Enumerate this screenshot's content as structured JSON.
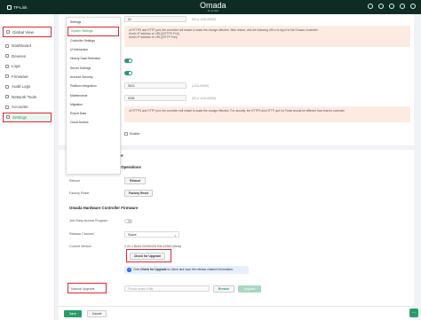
{
  "topbar": {
    "brand": "TP-Link",
    "product": "Omada",
    "product_sub": "by tp-link"
  },
  "sidebar": {
    "global_view": "Global View",
    "items": [
      {
        "label": "Dashboard",
        "icon": "dashboard-icon"
      },
      {
        "label": "Devices",
        "icon": "devices-icon"
      },
      {
        "label": "Logs",
        "icon": "logs-icon"
      },
      {
        "label": "Firmware",
        "icon": "firmware-icon"
      },
      {
        "label": "Audit Logs",
        "icon": "audit-logs-icon"
      },
      {
        "label": "Network Tools",
        "icon": "network-tools-icon"
      },
      {
        "label": "Accounts",
        "icon": "accounts-icon"
      },
      {
        "label": "Settings",
        "icon": "settings-icon"
      }
    ]
  },
  "dropdown": {
    "items": [
      "Settings",
      "System Settings",
      "Controller Settings",
      "UI Interaction",
      "History Data Retention",
      "Server Settings",
      "Account Security",
      "Platform Integration",
      "Maintenance",
      "Migration",
      "Export Data",
      "Cloud Access"
    ]
  },
  "http_section": {
    "port_value_1": "80",
    "port_hint_1": "(80 or 1024-65535)",
    "notice_1_lines": [
      "of HTTPS and HTTP port, the controller will restart to make the change effective. After restart, visit the following URLs to log in to the Omada Controller:",
      "Host's IP address or URL]:[HTTPS Port]",
      "Host's IP address or URL]:[HTTP Port]"
    ],
    "port_value_2": "8843",
    "port_hint_2": "(1024-65535)",
    "port_value_3": "8088",
    "port_hint_3": "(80 or 1024-65535)",
    "notice_2_lines": [
      "of HTTPS and HTTP port, the controller will restart to make the change effective. For security, the HTTPS and HTTP port for Portal should be different from that for controller"
    ],
    "device_management_label": "Device Management",
    "enable_label": "Enable"
  },
  "controller": {
    "title": "Omada Hardware Controller",
    "operations_title": "Omada Hardware Controller Operations",
    "reboot_label": "Reboot",
    "reboot_button": "Reboot",
    "factory_reset_label": "Factory Reset",
    "factory_reset_button": "Factory Reset",
    "firmware_title": "Omada Hardware Controller Firmware",
    "early_access_label": "Join Early Access Program",
    "release_channel_label": "Release Channel",
    "release_channel_value": "Stable",
    "current_version_label": "Current Version",
    "current_version_value": "2.20.1 Build 20250326 Rel.42983 (Beta)",
    "check_upgrade_button": "Check for Upgrade",
    "info_text_prefix": "Click",
    "info_text_bold": "Check for Upgrade",
    "info_text_suffix": "to check and save the release channel information.",
    "manual_upgrade_label": "Manual Upgrade",
    "file_placeholder": "Please select a file.",
    "browse_button": "Browse",
    "upgrade_button": "Upgrade"
  },
  "footer": {
    "save": "Save",
    "cancel": "Cancel"
  },
  "colors": {
    "accent": "#2a9d68",
    "highlight": "#e2242e",
    "topbar": "#0f2c24"
  }
}
